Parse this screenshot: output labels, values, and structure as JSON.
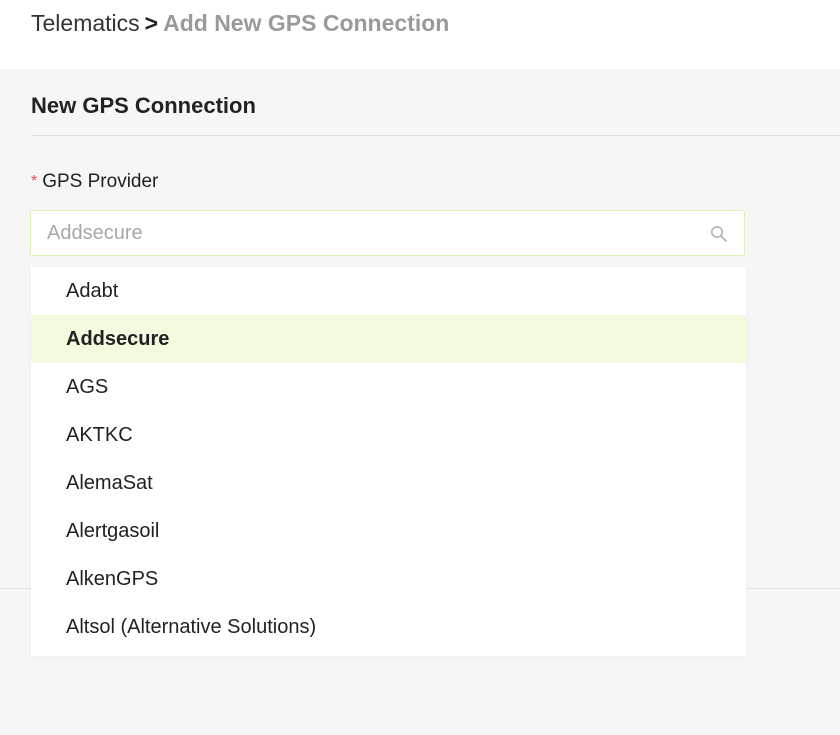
{
  "breadcrumb": {
    "root": "Telematics",
    "separator": ">",
    "current": "Add New GPS Connection"
  },
  "card": {
    "title": "New GPS Connection"
  },
  "gps_provider": {
    "required_mark": "*",
    "label": "GPS Provider",
    "placeholder": "Addsecure",
    "search_icon": "search-icon",
    "options": [
      {
        "label": "Adabt",
        "selected": false
      },
      {
        "label": "Addsecure",
        "selected": true
      },
      {
        "label": "AGS",
        "selected": false
      },
      {
        "label": "AKTKC",
        "selected": false
      },
      {
        "label": "AlemaSat",
        "selected": false
      },
      {
        "label": "Alertgasoil",
        "selected": false
      },
      {
        "label": "AlkenGPS",
        "selected": false
      },
      {
        "label": "Altsol (Alternative Solutions)",
        "selected": false
      }
    ]
  },
  "colors": {
    "required": "#e84a5f",
    "selected_option_bg": "#f3fbdf",
    "input_border": "#d9f2b4",
    "breadcrumb_current": "#9a9a9a"
  }
}
